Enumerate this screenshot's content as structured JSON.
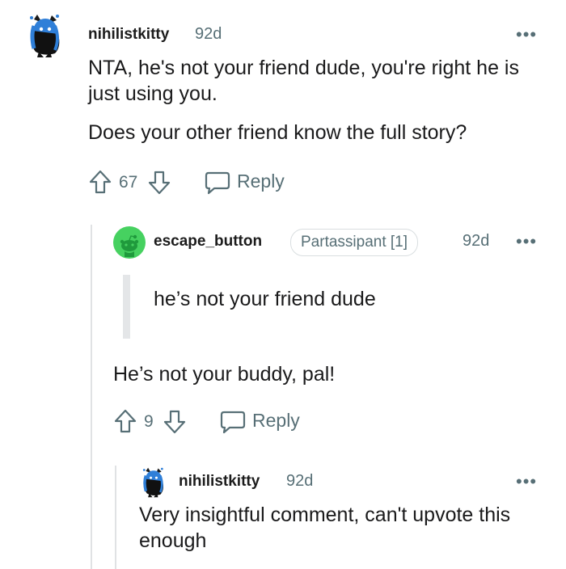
{
  "comments": [
    {
      "username": "nihilistkitty",
      "age": "92d",
      "more": "•••",
      "paragraphs": [
        "NTA, he's not your friend dude, you're right he is just using you.",
        "Does your other friend know the full story?"
      ],
      "votes": "67",
      "reply_label": "Reply"
    },
    {
      "username": "escape_button",
      "flair": "Partassipant [1]",
      "age": "92d",
      "more": "•••",
      "quote": "he’s not your friend dude",
      "paragraphs": [
        "He’s not your buddy, pal!"
      ],
      "votes": "9",
      "reply_label": "Reply"
    },
    {
      "username": "nihilistkitty",
      "age": "92d",
      "more": "•••",
      "paragraphs": [
        "Very insightful comment, can't upvote this enough"
      ]
    }
  ],
  "colors": {
    "meta_text": "#576f76",
    "body_text": "#1a1a1b",
    "snoo_avatar_bg": "#46d160",
    "kitty_avatar_fg": "#2f7fd8",
    "thread_line": "#e0e2e4",
    "quote_bar": "#e4e6e8"
  },
  "icons": [
    "avatar-kitty",
    "avatar-snoo",
    "upvote-arrow",
    "downvote-arrow",
    "speech-bubble",
    "more-dots"
  ]
}
